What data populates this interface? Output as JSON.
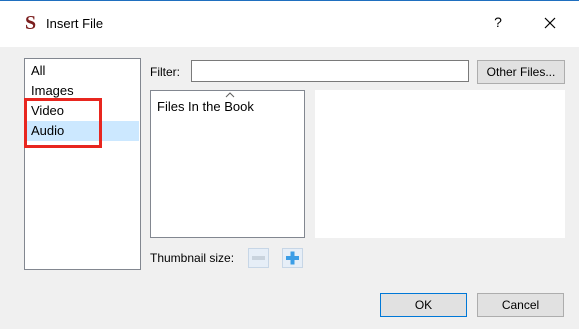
{
  "window": {
    "title": "Insert File",
    "app_icon_glyph": "S",
    "help_label": "?"
  },
  "categories": [
    {
      "label": "All",
      "selected": false
    },
    {
      "label": "Images",
      "selected": false
    },
    {
      "label": "Video",
      "selected": false
    },
    {
      "label": "Audio",
      "selected": true
    }
  ],
  "filter": {
    "label": "Filter:",
    "value": ""
  },
  "buttons": {
    "other_files": "Other Files...",
    "ok": "OK",
    "cancel": "Cancel"
  },
  "tree": {
    "items": [
      "Files In the Book"
    ]
  },
  "thumbnail": {
    "label": "Thumbnail size:"
  },
  "colors": {
    "highlight": "#e8261f",
    "selection": "#cce8ff",
    "app_icon": "#7b1e1e"
  }
}
